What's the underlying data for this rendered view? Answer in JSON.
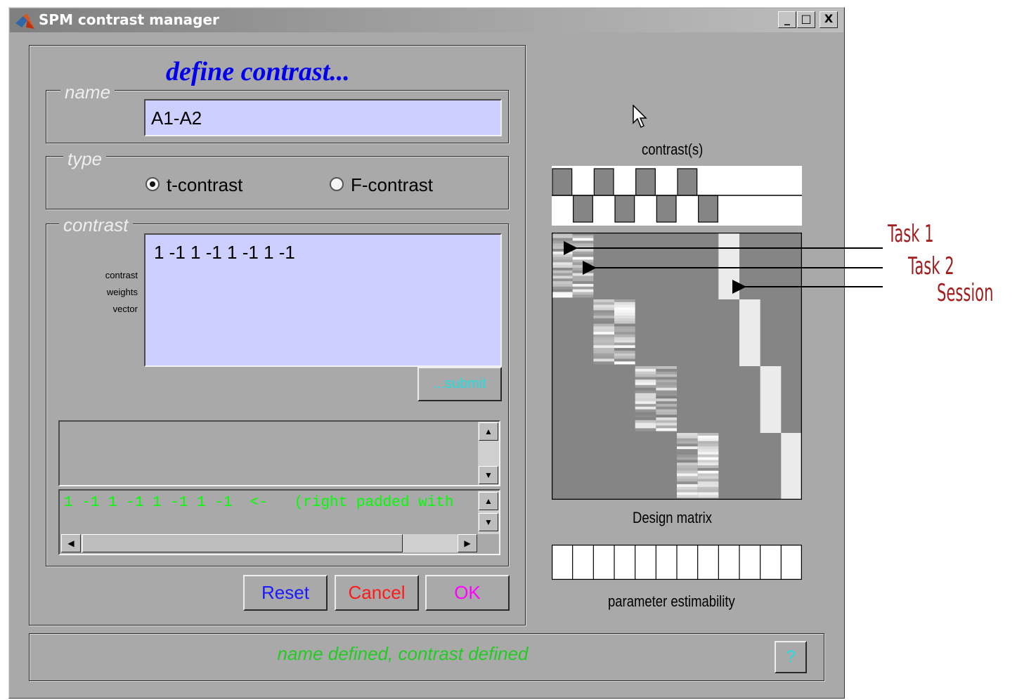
{
  "window": {
    "title": "SPM contrast manager",
    "minimize_label": "_",
    "maximize_label": "□",
    "close_label": "X"
  },
  "define": {
    "heading": "define contrast...",
    "name_group_label": "name",
    "name_value": "A1-A2",
    "type_group_label": "type",
    "type_options": [
      {
        "label": "t-contrast",
        "selected": true
      },
      {
        "label": "F-contrast",
        "selected": false
      }
    ],
    "contrast_group_label": "contrast",
    "weights_label_lines": [
      "contrast",
      "weights",
      "vector"
    ],
    "weights_value": "1 -1 1 -1 1 -1 1 -1",
    "submit_label": "...submit",
    "parsed_line": "1 -1 1 -1 1 -1 1 -1  <-   (right padded with "
  },
  "buttons": {
    "reset": "Reset",
    "cancel": "Cancel",
    "ok": "OK",
    "help": "?"
  },
  "status": {
    "message": "name defined, contrast defined"
  },
  "figure": {
    "contrast_caption": "contrast(s)",
    "contrast_weights": [
      1,
      -1,
      1,
      -1,
      1,
      -1,
      1,
      -1,
      0,
      0,
      0,
      0
    ],
    "design_caption": "Design matrix",
    "estimability_caption": "parameter estimability",
    "estimability_cells": 12
  },
  "annotations": {
    "task1": "Task 1",
    "task2": "Task 2",
    "session": "Session"
  },
  "colors": {
    "edit_bg": "#cccfff",
    "heading": "#0000ee",
    "status_text": "#22cc22",
    "parsed_text": "#00ff00",
    "submit_text": "#22dddd",
    "reset_text": "#1a1aff",
    "cancel_text": "#ff1a1a",
    "ok_text": "#ff00ff",
    "annotation": "#a21d1d"
  }
}
